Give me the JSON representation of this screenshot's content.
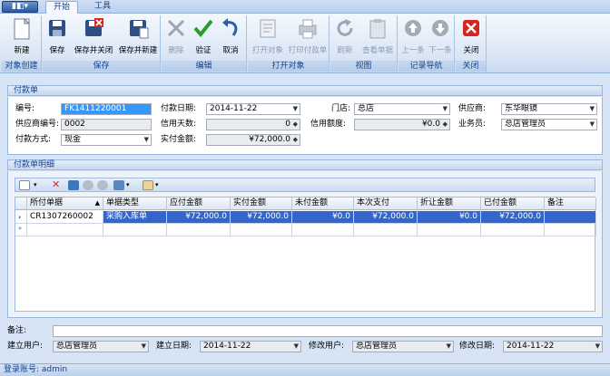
{
  "app_button_label": "▮◧▾",
  "tabs": [
    "开始",
    "工具"
  ],
  "ribbon": {
    "groups": [
      {
        "label": "对象创建",
        "buttons": [
          "新建"
        ]
      },
      {
        "label": "保存",
        "buttons": [
          "保存",
          "保存并关闭",
          "保存并新建"
        ]
      },
      {
        "label": "编辑",
        "buttons": [
          "删除",
          "验证",
          "取消"
        ]
      },
      {
        "label": "打开对象",
        "buttons": [
          "打开对象",
          "打印付款单"
        ]
      },
      {
        "label": "视图",
        "buttons": [
          "刷新",
          "查看单据"
        ]
      },
      {
        "label": "记录导航",
        "buttons": [
          "上一条",
          "下一条"
        ]
      },
      {
        "label": "关闭",
        "buttons": [
          "关闭"
        ]
      }
    ]
  },
  "header_panel": {
    "title": "付款单",
    "fields": {
      "code_label": "编号:",
      "code_value": "FK1411220001",
      "pay_date_label": "付款日期:",
      "pay_date_value": "2014-11-22",
      "store_label": "门店:",
      "store_value": "总店",
      "supplier_label": "供应商:",
      "supplier_value": "东华眼镜",
      "supplier_code_label": "供应商编号:",
      "supplier_code_value": "0002",
      "credit_days_label": "信用天数:",
      "credit_days_value": "0",
      "credit_limit_label": "信用额度:",
      "credit_limit_value": "¥0.0",
      "salesman_label": "业务员:",
      "salesman_value": "总店管理员",
      "pay_method_label": "付款方式:",
      "pay_method_value": "现金",
      "actual_amount_label": "实付金额:",
      "actual_amount_value": "¥72,000.0"
    }
  },
  "detail_panel": {
    "title": "付款单明细",
    "columns": [
      "所付单据",
      "单据类型",
      "应付金额",
      "实付金额",
      "未付金额",
      "本次支付",
      "折让金额",
      "已付金额",
      "备注"
    ],
    "rows": [
      [
        "CR1307260002",
        "采购入库单",
        "¥72,000.0",
        "¥72,000.0",
        "¥0.0",
        "¥72,000.0",
        "¥0.0",
        "¥72,000.0",
        ""
      ]
    ]
  },
  "footer": {
    "remark_label": "备注:",
    "remark_value": "",
    "creator_label": "建立用户:",
    "creator_value": "总店管理员",
    "create_date_label": "建立日期:",
    "create_date_value": "2014-11-22",
    "modifier_label": "修改用户:",
    "modifier_value": "总店管理员",
    "modify_date_label": "修改日期:",
    "modify_date_value": "2014-11-22"
  },
  "status_bar": "登录账号: admin",
  "colors": {
    "ribbon_bg": "#dbe7f6",
    "selected_row": "#3366cc",
    "close_red": "#d7261e"
  }
}
